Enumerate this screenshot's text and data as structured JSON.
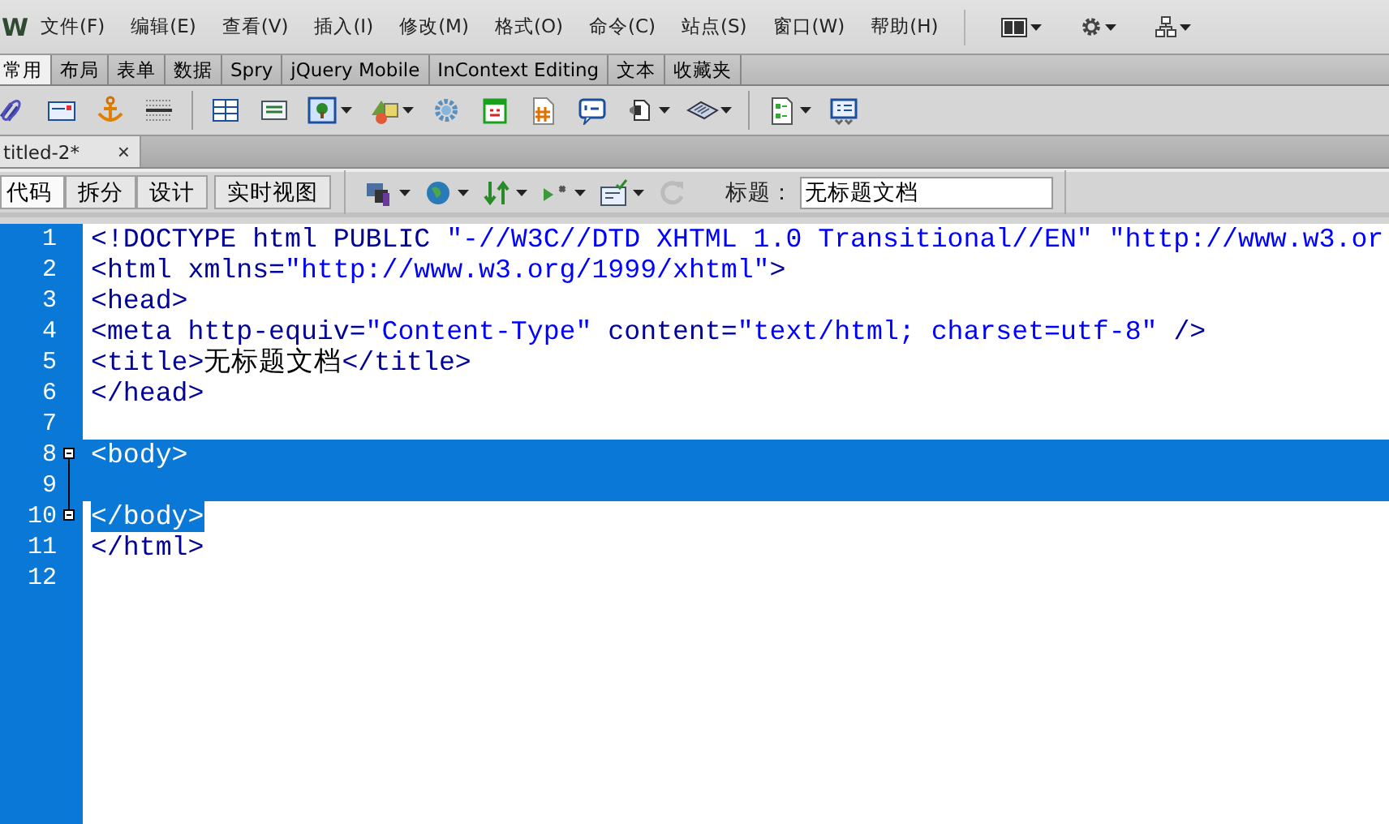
{
  "app": {
    "logo": "W"
  },
  "menu": [
    {
      "label": "文件(F)"
    },
    {
      "label": "编辑(E)"
    },
    {
      "label": "查看(V)"
    },
    {
      "label": "插入(I)"
    },
    {
      "label": "修改(M)"
    },
    {
      "label": "格式(O)"
    },
    {
      "label": "命令(C)"
    },
    {
      "label": "站点(S)"
    },
    {
      "label": "窗口(W)"
    },
    {
      "label": "帮助(H)"
    }
  ],
  "insert_tabs": [
    {
      "label": "常用",
      "selected": true
    },
    {
      "label": "布局",
      "selected": false
    },
    {
      "label": "表单",
      "selected": false
    },
    {
      "label": "数据",
      "selected": false
    },
    {
      "label": "Spry",
      "selected": false
    },
    {
      "label": "jQuery Mobile",
      "selected": false
    },
    {
      "label": "InContext Editing",
      "selected": false
    },
    {
      "label": "文本",
      "selected": false
    },
    {
      "label": "收藏夹",
      "selected": false
    }
  ],
  "document_tab": {
    "title": "titled-2*",
    "close": "×"
  },
  "view_buttons": [
    {
      "label": "代码",
      "selected": true
    },
    {
      "label": "拆分",
      "selected": false
    },
    {
      "label": "设计",
      "selected": false
    },
    {
      "label": "实时视图",
      "selected": false
    }
  ],
  "title_field": {
    "label": "标题：",
    "value": "无标题文档"
  },
  "code": {
    "lines": [
      {
        "number": "1",
        "selected": false,
        "fold_marker": false,
        "segments": [
          {
            "kind": "tag",
            "text": "<!DOCTYPE html PUBLIC "
          },
          {
            "kind": "value",
            "text": "\"-//W3C//DTD XHTML 1.0 Transitional//EN\" \"http://www.w3.or"
          }
        ]
      },
      {
        "number": "2",
        "selected": false,
        "fold_marker": false,
        "segments": [
          {
            "kind": "tag",
            "text": "<html xmlns="
          },
          {
            "kind": "value",
            "text": "\"http://www.w3.org/1999/xhtml\""
          },
          {
            "kind": "tag",
            "text": ">"
          }
        ]
      },
      {
        "number": "3",
        "selected": false,
        "fold_marker": false,
        "segments": [
          {
            "kind": "tag",
            "text": "<head>"
          }
        ]
      },
      {
        "number": "4",
        "selected": false,
        "fold_marker": false,
        "segments": [
          {
            "kind": "tag",
            "text": "<meta http-equiv="
          },
          {
            "kind": "value",
            "text": "\"Content-Type\""
          },
          {
            "kind": "tag",
            "text": " content="
          },
          {
            "kind": "value",
            "text": "\"text/html; charset=utf-8\""
          },
          {
            "kind": "tag",
            "text": " />"
          }
        ]
      },
      {
        "number": "5",
        "selected": false,
        "fold_marker": false,
        "segments": [
          {
            "kind": "tag",
            "text": "<title>"
          },
          {
            "kind": "text",
            "text": "无标题文档"
          },
          {
            "kind": "tag",
            "text": "</title>"
          }
        ]
      },
      {
        "number": "6",
        "selected": false,
        "fold_marker": false,
        "segments": [
          {
            "kind": "tag",
            "text": "</head>"
          }
        ]
      },
      {
        "number": "7",
        "selected": false,
        "fold_marker": false
      },
      {
        "number": "8",
        "selected": true,
        "fold_marker": true,
        "segments": [
          {
            "kind": "tag",
            "text": "<body>"
          }
        ]
      },
      {
        "number": "9",
        "selected": true,
        "fold_marker": false
      },
      {
        "number": "10",
        "selected": true,
        "fold_marker": true,
        "segments": [
          {
            "kind": "tag",
            "text": "</body>"
          }
        ]
      },
      {
        "number": "11",
        "selected": false,
        "fold_marker": false,
        "segments": [
          {
            "kind": "tag",
            "text": "</html>"
          }
        ]
      },
      {
        "number": "12",
        "selected": false,
        "fold_marker": false
      }
    ]
  }
}
